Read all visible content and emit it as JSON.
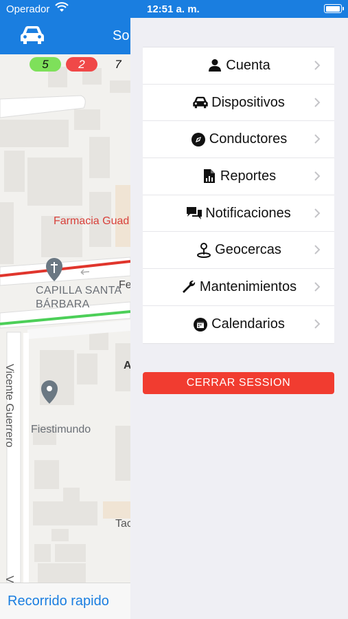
{
  "status_bar": {
    "carrier": "Operador",
    "time": "12:51 a. m."
  },
  "left_app": {
    "title": "So",
    "badges": [
      "5",
      "2",
      "7"
    ],
    "map_labels": {
      "farmacia": "Farmacia Guad",
      "capilla": "CAPILLA SANTA",
      "capilla2": "BÁRBARA",
      "fe": "Fe",
      "a": "A",
      "fiestimundo": "Fiestimundo",
      "ta": "Tac",
      "vicente": "Vicente Guerrero",
      "vice2": "Vice"
    },
    "bottom_link": "Recorrido rapido"
  },
  "drawer": {
    "menu": [
      {
        "label": "Cuenta",
        "icon": "user-icon"
      },
      {
        "label": "Dispositivos",
        "icon": "car-icon"
      },
      {
        "label": "Conductores",
        "icon": "steering-icon"
      },
      {
        "label": "Reportes",
        "icon": "report-icon"
      },
      {
        "label": "Notificaciones",
        "icon": "chat-icon"
      },
      {
        "label": "Geocercas",
        "icon": "map-pin-icon"
      },
      {
        "label": "Mantenimientos",
        "icon": "wrench-icon"
      },
      {
        "label": "Calendarios",
        "icon": "calendar-icon"
      }
    ],
    "logout_label": "CERRAR SESSION"
  },
  "colors": {
    "primary": "#1a7ee0",
    "danger": "#f13c30",
    "badge_green": "#7ee05a",
    "badge_red": "#f04848"
  }
}
